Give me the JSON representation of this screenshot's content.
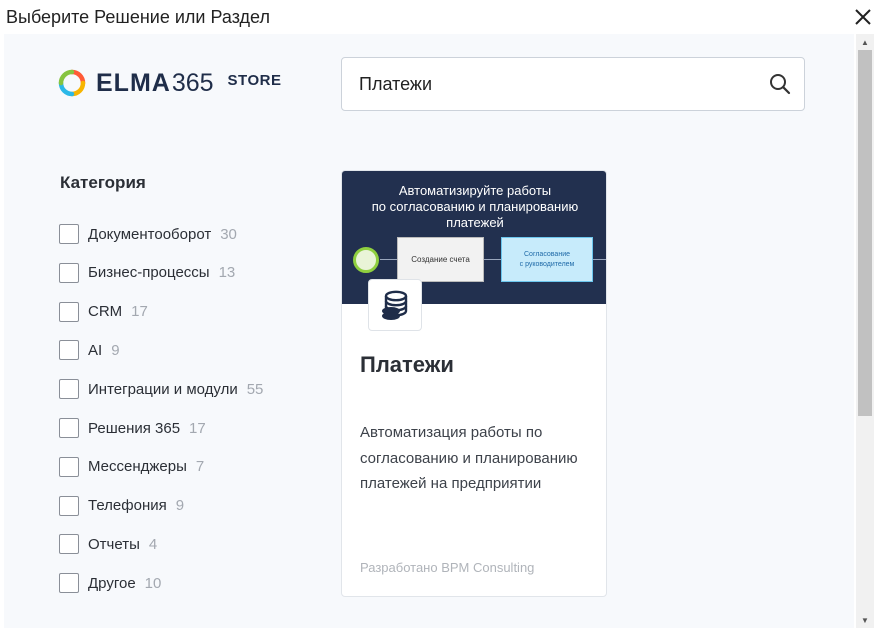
{
  "window": {
    "title": "Выберите Решение или Раздел",
    "close_icon": "close-icon"
  },
  "logo": {
    "word": "ELMA",
    "number": "365",
    "store": "STORE"
  },
  "search": {
    "value": "Платежи",
    "icon": "search-icon"
  },
  "categories": {
    "title": "Категория",
    "items": [
      {
        "label": "Документооборот",
        "count": "30",
        "checked": false
      },
      {
        "label": "Бизнес-процессы",
        "count": "13",
        "checked": false
      },
      {
        "label": "CRM",
        "count": "17",
        "checked": false
      },
      {
        "label": "AI",
        "count": "9",
        "checked": false
      },
      {
        "label": "Интеграции и модули",
        "count": "55",
        "checked": false
      },
      {
        "label": "Решения 365",
        "count": "17",
        "checked": false
      },
      {
        "label": "Мессенджеры",
        "count": "7",
        "checked": false
      },
      {
        "label": "Телефония",
        "count": "9",
        "checked": false
      },
      {
        "label": "Отчеты",
        "count": "4",
        "checked": false
      },
      {
        "label": "Другое",
        "count": "10",
        "checked": false
      }
    ]
  },
  "card": {
    "banner_lines": [
      "Автоматизируйте работы",
      "по согласованию и планированию",
      "платежей"
    ],
    "flow_box1": "Создание счета",
    "flow_box2_line1": "Согласование",
    "flow_box2_line2": "с руководителем",
    "icon": "coins-icon",
    "title": "Платежи",
    "description": "Автоматизация работы по согласованию и планированию платежей на предприятии",
    "developer": "Разработано BPM Consulting"
  },
  "colors": {
    "banner_bg": "#22304f",
    "brand_text": "#1f2d49",
    "flow_start": "#8fcf3f",
    "flow_box2": "#c7ebfb"
  }
}
